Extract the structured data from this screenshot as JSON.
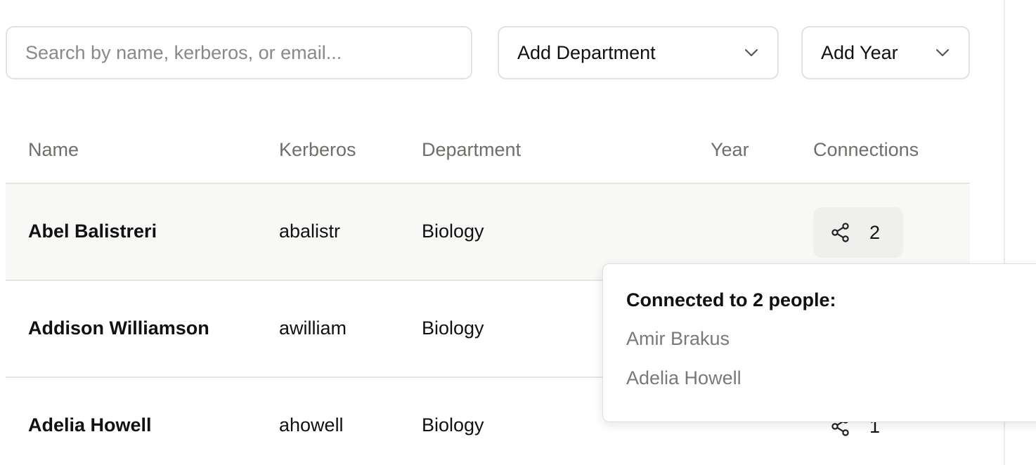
{
  "filters": {
    "search_placeholder": "Search by name, kerberos, or email...",
    "department_label": "Add Department",
    "year_label": "Add Year"
  },
  "table": {
    "headers": {
      "name": "Name",
      "kerberos": "Kerberos",
      "department": "Department",
      "year": "Year",
      "connections": "Connections"
    },
    "rows": [
      {
        "name": "Abel Balistreri",
        "kerberos": "abalistr",
        "department": "Biology",
        "year": "",
        "connections": "2"
      },
      {
        "name": "Addison Williamson",
        "kerberos": "awilliam",
        "department": "Biology",
        "year": "",
        "connections": ""
      },
      {
        "name": "Adelia Howell",
        "kerberos": "ahowell",
        "department": "Biology",
        "year": "",
        "connections": "1"
      }
    ]
  },
  "popover": {
    "title": "Connected to 2 people:",
    "people": [
      "Amir Brakus",
      "Adelia Howell"
    ]
  },
  "icons": {
    "connections": "share-icon",
    "dropdown": "chevron-down-icon"
  }
}
